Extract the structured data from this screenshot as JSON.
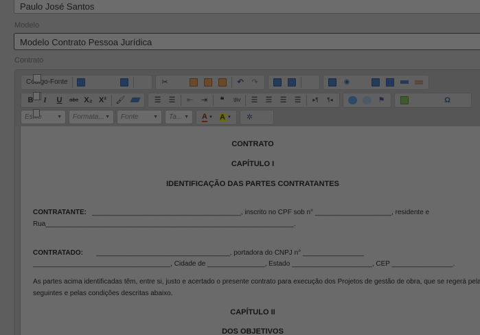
{
  "form": {
    "nome_value": "Paulo José Santos",
    "modelo_label": "Modelo",
    "modelo_value": "Modelo Contrato Pessoa Jurídica",
    "contrato_label": "Contrato"
  },
  "toolbar": {
    "source_label": "Código-Fonte",
    "style_placeholder": "Estilo",
    "format_placeholder": "Formata...",
    "font_placeholder": "Fonte",
    "size_placeholder": "Ta...",
    "bold": "B",
    "italic": "I",
    "underline": "U",
    "strike": "abc",
    "subscript": "X₂",
    "superscript": "X²"
  },
  "document": {
    "title": "CONTRATO",
    "chapter1": "CAPÍTULO I",
    "chapter1_title": "IDENTIFICAÇÃO DAS PARTES CONTRATANTES",
    "contratante_label": "CONTRATANTE:",
    "contratante_line1": "_______________________________________,   inscrito   no   CPF   sob   n°   ____________________,   residente   e",
    "contratante_line2": "Rua_________________________________________________________________.",
    "contratado_label": "CONTRATADO:",
    "contratado_line1": "___________________________________,          portadora          do          CNPJ          n°          ________________",
    "contratado_line2": "____________________________________, Cidade de _______________, Estado _____________________, CEP ________________.",
    "para_line1": "As partes acima identificadas têm, entre si, justo e acertado o presente contrato para execução dos Projetos de gestão de obra, que se regerá pelas clá",
    "para_line2": "seguintes e pelas condições descritas abaixo.",
    "chapter2": "CAPÍTULO II",
    "chapter2_title": "DOS OBJETIVOS"
  }
}
